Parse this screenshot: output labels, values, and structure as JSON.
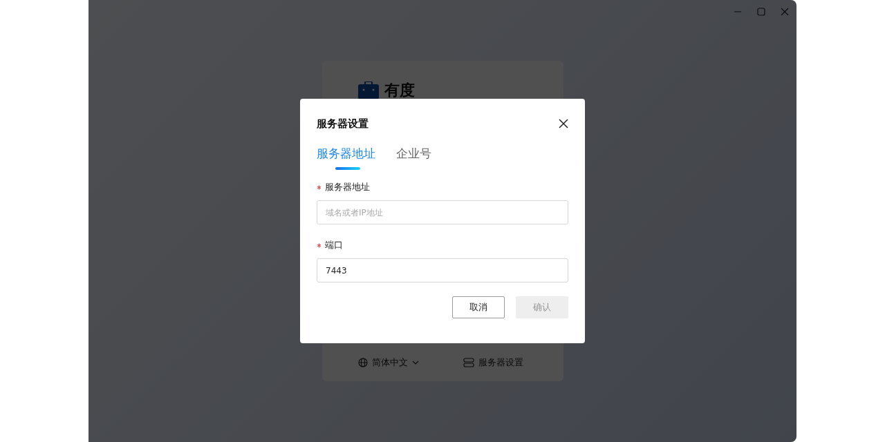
{
  "background": {
    "brand": "有度",
    "language": "简体中文",
    "server_settings_link": "服务器设置"
  },
  "dialog": {
    "title": "服务器设置",
    "tabs": [
      {
        "label": "服务器地址",
        "selected": true
      },
      {
        "label": "企业号",
        "selected": false
      }
    ],
    "fields": [
      {
        "label": "服务器地址",
        "required": true,
        "placeholder": "域名或者IP地址"
      },
      {
        "label": "端口",
        "required": true,
        "value": "7443"
      }
    ],
    "buttons": [
      {
        "label": "取消",
        "kind": "secondary",
        "disabled": false
      },
      {
        "label": "确认",
        "kind": "primary",
        "disabled": true
      }
    ]
  }
}
